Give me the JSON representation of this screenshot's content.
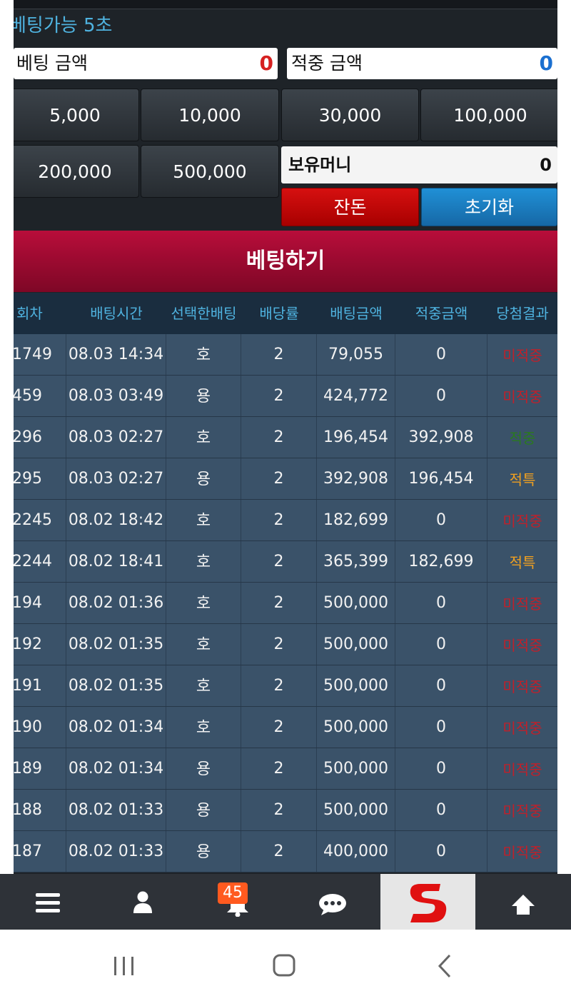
{
  "header": {
    "countdown": "베팅가능 5초",
    "bet_amount_label": "베팅 금액",
    "bet_amount_value": "0",
    "win_amount_label": "적중 금액",
    "win_amount_value": "0"
  },
  "chips": [
    "5,000",
    "10,000",
    "30,000",
    "100,000",
    "200,000",
    "500,000"
  ],
  "holding": {
    "label": "보유머니",
    "value": "0"
  },
  "actions": {
    "change": "잔돈",
    "reset": "초기화"
  },
  "bet_button": "베팅하기",
  "table": {
    "headers": [
      "회차",
      "배팅시간",
      "선택한배팅",
      "배당률",
      "배팅금액",
      "적중금액",
      "당첨결과"
    ],
    "rows": [
      [
        "1749",
        "08.03 14:34",
        "호",
        "2",
        "79,055",
        "0",
        "미적중"
      ],
      [
        "459",
        "08.03 03:49",
        "용",
        "2",
        "424,772",
        "0",
        "미적중"
      ],
      [
        "296",
        "08.03 02:27",
        "호",
        "2",
        "196,454",
        "392,908",
        "적중"
      ],
      [
        "295",
        "08.03 02:27",
        "용",
        "2",
        "392,908",
        "196,454",
        "적특"
      ],
      [
        "2245",
        "08.02 18:42",
        "호",
        "2",
        "182,699",
        "0",
        "미적중"
      ],
      [
        "2244",
        "08.02 18:41",
        "호",
        "2",
        "365,399",
        "182,699",
        "적특"
      ],
      [
        "194",
        "08.02 01:36",
        "호",
        "2",
        "500,000",
        "0",
        "미적중"
      ],
      [
        "192",
        "08.02 01:35",
        "호",
        "2",
        "500,000",
        "0",
        "미적중"
      ],
      [
        "191",
        "08.02 01:35",
        "호",
        "2",
        "500,000",
        "0",
        "미적중"
      ],
      [
        "190",
        "08.02 01:34",
        "호",
        "2",
        "500,000",
        "0",
        "미적중"
      ],
      [
        "189",
        "08.02 01:34",
        "용",
        "2",
        "500,000",
        "0",
        "미적중"
      ],
      [
        "188",
        "08.02 01:33",
        "용",
        "2",
        "500,000",
        "0",
        "미적중"
      ],
      [
        "187",
        "08.02 01:33",
        "용",
        "2",
        "400,000",
        "0",
        "미적중"
      ]
    ]
  },
  "result_colors": {
    "미적중": "#c0202a",
    "적중": "#2a7a1e",
    "적특": "#f0a020"
  },
  "nav": {
    "items": [
      "menu-icon",
      "user-icon",
      "bell-icon",
      "chat-icon",
      "logo",
      "arrow-up-icon"
    ],
    "notification_count": "45"
  },
  "colors": {
    "accent_blue": "#4fb3e0",
    "bet_red": "#b80d3a",
    "reset_blue": "#1e7fc4",
    "change_red": "#c80a0a",
    "win_blue": "#1a6fd0",
    "bet_value_red": "#d62020"
  }
}
